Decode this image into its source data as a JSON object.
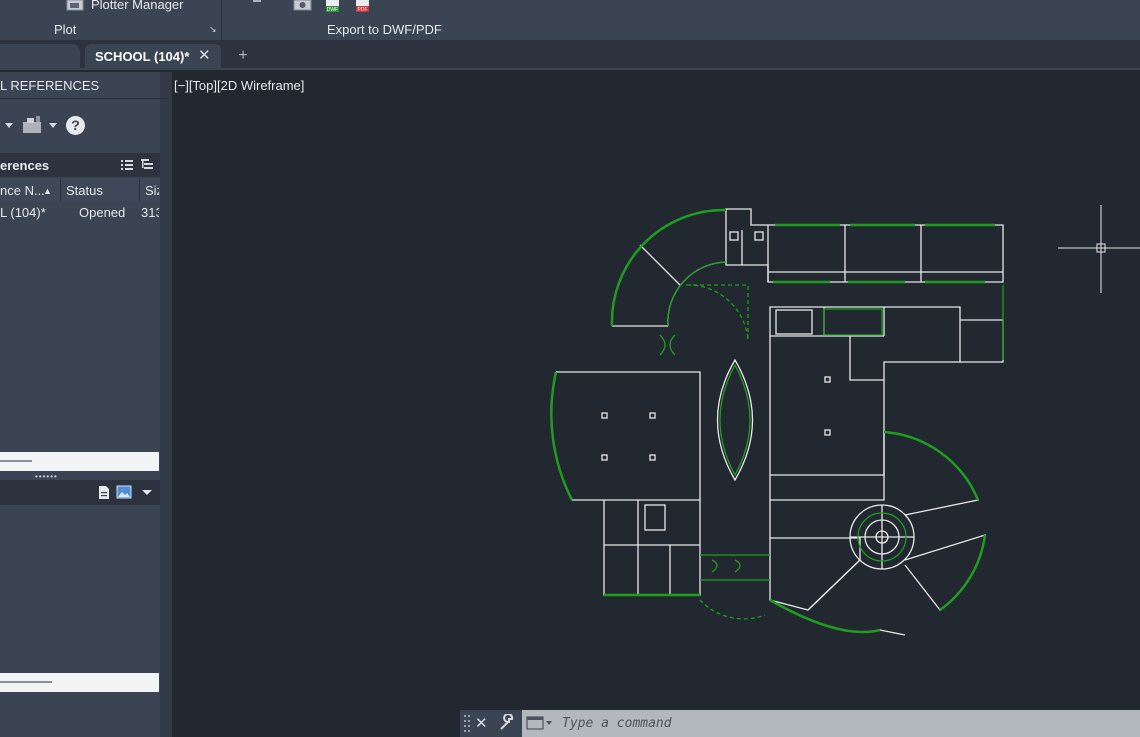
{
  "ribbon": {
    "plotter_manager_label": "Plotter Manager",
    "plot_panel_label": "Plot",
    "export_panel_label": "Export to DWF/PDF",
    "dwf_icon_text": "DWF",
    "pdf_icon_text": "PDF",
    "launcher_glyph": "↘"
  },
  "tabs": {
    "active_title": "SCHOOL (104)*",
    "close_glyph": "✕",
    "add_glyph": "+"
  },
  "palette": {
    "title": "L REFERENCES",
    "references_header": "erences",
    "columns": [
      "nce N...",
      "Status",
      "Siz"
    ],
    "sort_glyph": "▲",
    "rows": [
      {
        "name": "L (104)*",
        "status": "Opened",
        "size": "313"
      }
    ],
    "help_glyph": "?",
    "grip_glyph": "••••••"
  },
  "viewport": {
    "label": "[−][Top][2D Wireframe]"
  },
  "command_line": {
    "placeholder": "Type a command",
    "close_glyph": "✕"
  },
  "colors": {
    "background": "#212830",
    "panel": "#3b4453",
    "wall_lines": "#e8e8e8",
    "door_window_lines": "#1f9d20"
  }
}
